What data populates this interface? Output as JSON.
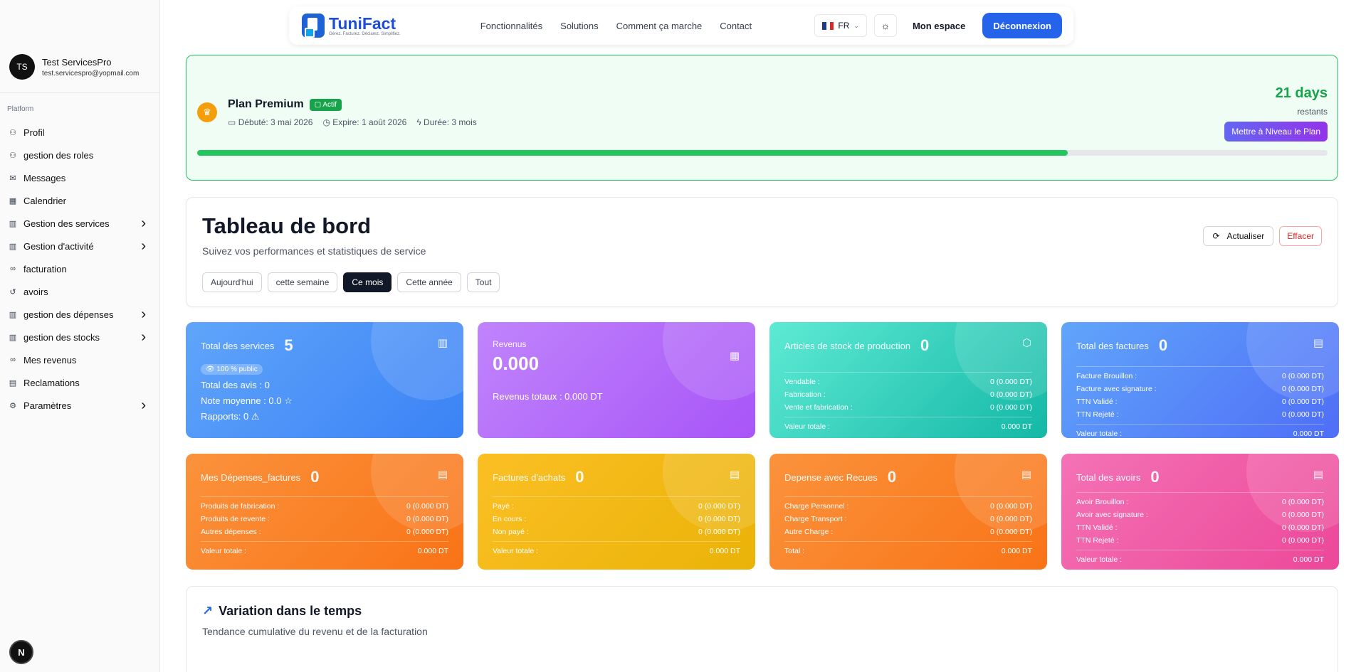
{
  "brand": {
    "name": "TuniFact",
    "tagline": "Gérez. Facturez. Déclarez. Simplifiez."
  },
  "nav": {
    "links": [
      "Fonctionnalités",
      "Solutions",
      "Comment ça marche",
      "Contact"
    ],
    "lang": "FR",
    "my_space": "Mon espace",
    "logout": "Déconnexion"
  },
  "user": {
    "initials": "TS",
    "name": "Test ServicesPro",
    "email": "test.servicespro@yopmail.com"
  },
  "sidebar": {
    "group": "Platform",
    "items": [
      {
        "label": "Profil",
        "icon": "user-icon",
        "glyph": "⚇",
        "chevron": false
      },
      {
        "label": "gestion des roles",
        "icon": "user-cog-icon",
        "glyph": "⚇",
        "chevron": false
      },
      {
        "label": "Messages",
        "icon": "messages-icon",
        "glyph": "✉",
        "chevron": false
      },
      {
        "label": "Calendrier",
        "icon": "calendar-icon",
        "glyph": "▦",
        "chevron": false
      },
      {
        "label": "Gestion des services",
        "icon": "briefcase-icon",
        "glyph": "▥",
        "chevron": true
      },
      {
        "label": "Gestion d'activité",
        "icon": "briefcase-icon",
        "glyph": "▥",
        "chevron": true
      },
      {
        "label": "facturation",
        "icon": "link-icon",
        "glyph": "∞",
        "chevron": false
      },
      {
        "label": "avoirs",
        "icon": "undo-icon",
        "glyph": "↺",
        "chevron": false
      },
      {
        "label": "gestion des dépenses",
        "icon": "briefcase-icon",
        "glyph": "▥",
        "chevron": true
      },
      {
        "label": "gestion des stocks",
        "icon": "briefcase-icon",
        "glyph": "▥",
        "chevron": true
      },
      {
        "label": "Mes revenus",
        "icon": "link-icon",
        "glyph": "∞",
        "chevron": false
      },
      {
        "label": "Reclamations",
        "icon": "document-icon",
        "glyph": "▤",
        "chevron": false
      },
      {
        "label": "Paramètres",
        "icon": "settings-icon",
        "glyph": "⚙",
        "chevron": true
      }
    ]
  },
  "plan": {
    "title": "Plan Premium",
    "status": "Actif",
    "started": "Débuté: 3 mai 2026",
    "expires": "Expire: 1 août 2026",
    "duration": "Durée: 3 mois",
    "days_left": "21 days",
    "days_left_label": "restants",
    "upgrade": "Mettre à Niveau le Plan",
    "progress_percent": 77
  },
  "dashboard": {
    "title": "Tableau de bord",
    "subtitle": "Suivez vos performances et statistiques de service",
    "filters": [
      "Aujourd'hui",
      "cette semaine",
      "Ce mois",
      "Cette année",
      "Tout"
    ],
    "active_filter": "Ce mois",
    "refresh": "Actualiser",
    "clear": "Effacer"
  },
  "cards": {
    "services": {
      "title": "Total des services",
      "value": "5",
      "public": "100 % public",
      "reviews": "Total des avis : 0",
      "rating": "Note moyenne : 0.0",
      "reports": "Rapports: 0"
    },
    "revenus": {
      "title": "Revenus",
      "value": "0.000",
      "total": "Revenus totaux : 0.000 DT"
    },
    "stock": {
      "title": "Articles de stock de production",
      "value": "0",
      "rows": [
        {
          "label": "Vendable :",
          "value": "0 (0.000 DT)"
        },
        {
          "label": "Fabrication :",
          "value": "0 (0.000 DT)"
        },
        {
          "label": "Vente et fabrication :",
          "value": "0 (0.000 DT)"
        }
      ],
      "total_label": "Valeur totale :",
      "total_value": "0.000 DT"
    },
    "factures": {
      "title": "Total des factures",
      "value": "0",
      "rows": [
        {
          "label": "Facture Brouillon :",
          "value": "0 (0.000 DT)"
        },
        {
          "label": "Facture avec signature :",
          "value": "0 (0.000 DT)"
        },
        {
          "label": "TTN Validé :",
          "value": "0 (0.000 DT)"
        },
        {
          "label": "TTN Rejeté :",
          "value": "0 (0.000 DT)"
        }
      ],
      "total_label": "Valeur totale :",
      "total_value": "0.000 DT"
    },
    "depenses": {
      "title": "Mes Dépenses_factures",
      "value": "0",
      "rows": [
        {
          "label": "Produits de fabrication :",
          "value": "0 (0.000 DT)"
        },
        {
          "label": "Produits de revente :",
          "value": "0 (0.000 DT)"
        },
        {
          "label": "Autres dépenses :",
          "value": "0 (0.000 DT)"
        }
      ],
      "total_label": "Valeur totale :",
      "total_value": "0.000 DT"
    },
    "achats": {
      "title": "Factures d'achats",
      "value": "0",
      "rows": [
        {
          "label": "Payé :",
          "value": "0 (0.000 DT)"
        },
        {
          "label": "En cours :",
          "value": "0 (0.000 DT)"
        },
        {
          "label": "Non payé :",
          "value": "0 (0.000 DT)"
        }
      ],
      "total_label": "Valeur totale :",
      "total_value": "0.000 DT"
    },
    "recues": {
      "title": "Depense avec Recues",
      "value": "0",
      "rows": [
        {
          "label": "Charge Personnel :",
          "value": "0 (0.000 DT)"
        },
        {
          "label": "Charge Transport :",
          "value": "0 (0.000 DT)"
        },
        {
          "label": "Autre Charge :",
          "value": "0 (0.000 DT)"
        }
      ],
      "total_label": "Total :",
      "total_value": "0.000 DT"
    },
    "avoirs": {
      "title": "Total des avoirs",
      "value": "0",
      "rows": [
        {
          "label": "Avoir Brouillon :",
          "value": "0 (0.000 DT)"
        },
        {
          "label": "Avoir avec signature :",
          "value": "0 (0.000 DT)"
        },
        {
          "label": "TTN Validé :",
          "value": "0 (0.000 DT)"
        },
        {
          "label": "TTN Rejeté :",
          "value": "0 (0.000 DT)"
        }
      ],
      "total_label": "Valeur totale :",
      "total_value": "0.000 DT"
    }
  },
  "variation": {
    "title": "Variation dans le temps",
    "subtitle": "Tendance cumulative du revenu et de la facturation"
  },
  "footer_badge": "N"
}
